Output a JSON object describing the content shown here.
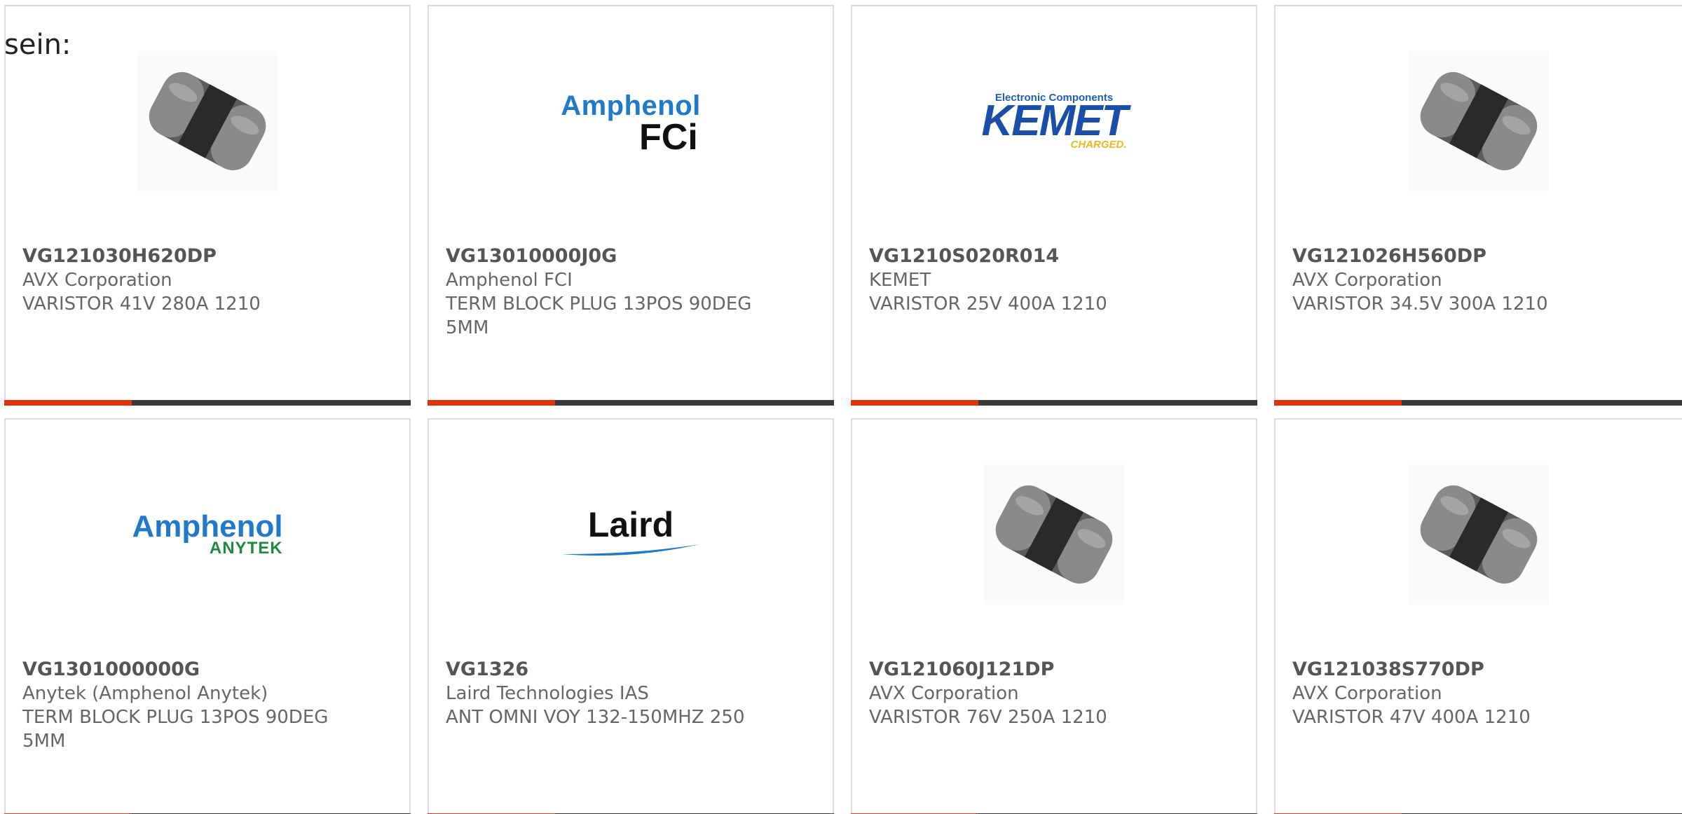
{
  "intro_text": "sein:",
  "cards": [
    {
      "part_number": "VG121030H620DP",
      "manufacturer": "AVX Corporation",
      "description": "VARISTOR 41V 280A 1210",
      "image": "varistor-chip"
    },
    {
      "part_number": "VG13010000J0G",
      "manufacturer": "Amphenol FCI",
      "description": "TERM BLOCK PLUG 13POS 90DEG 5MM",
      "image": "amphenol-fci-logo",
      "logo": {
        "line1": "Amphenol",
        "line2": "FCi"
      }
    },
    {
      "part_number": "VG1210S020R014",
      "manufacturer": "KEMET",
      "description": "VARISTOR 25V 400A 1210",
      "image": "kemet-logo",
      "logo": {
        "line0": "Electronic Components",
        "line1": "KEMET",
        "line2": "CHARGED."
      }
    },
    {
      "part_number": "VG121026H560DP",
      "manufacturer": "AVX Corporation",
      "description": "VARISTOR 34.5V 300A 1210",
      "image": "varistor-chip"
    },
    {
      "part_number": "VG1301000000G",
      "manufacturer": "Anytek (Amphenol Anytek)",
      "description": "TERM BLOCK PLUG 13POS 90DEG 5MM",
      "image": "amphenol-anytek-logo",
      "logo": {
        "line1": "Amphenol",
        "line2": "ANYTEK"
      }
    },
    {
      "part_number": "VG1326",
      "manufacturer": "Laird Technologies IAS",
      "description": "ANT OMNI VOY 132-150MHZ 250",
      "image": "laird-logo",
      "logo": {
        "line1": "Laird"
      }
    },
    {
      "part_number": "VG121060J121DP",
      "manufacturer": "AVX Corporation",
      "description": "VARISTOR 76V 250A 1210",
      "image": "varistor-chip"
    },
    {
      "part_number": "VG121038S770DP",
      "manufacturer": "AVX Corporation",
      "description": "VARISTOR 47V 400A 1210",
      "image": "varistor-chip"
    }
  ],
  "colors": {
    "accent": "#e0330e",
    "bar": "#3a3a3a",
    "border": "#dcdcdc"
  }
}
